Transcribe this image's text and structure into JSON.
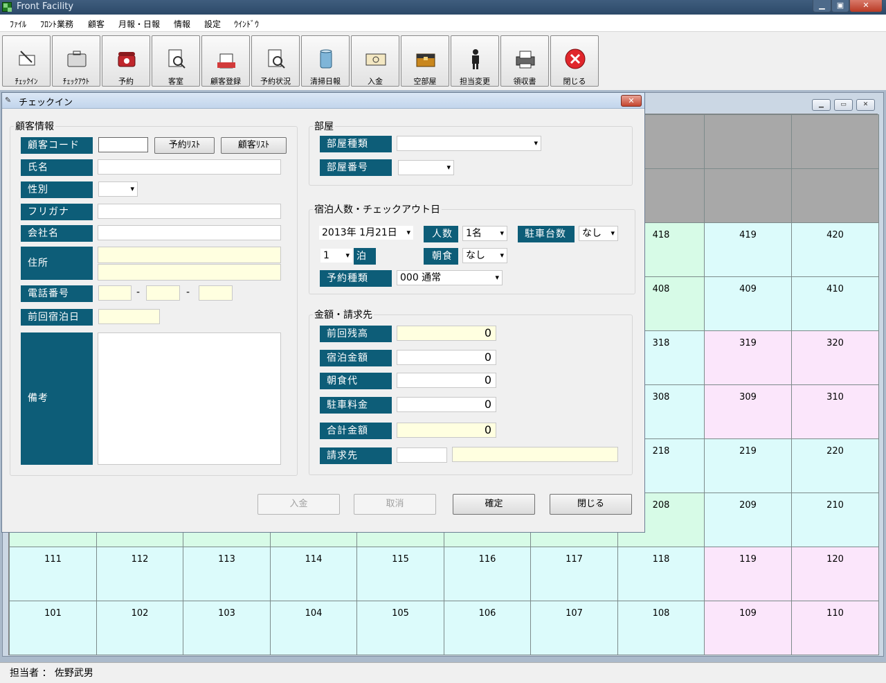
{
  "window": {
    "title": "Front Facility"
  },
  "menu": [
    "ﾌｧｲﾙ",
    "ﾌﾛﾝﾄ業務",
    "顧客",
    "月報・日報",
    "情報",
    "設定",
    "ｳｲﾝﾄﾞｳ"
  ],
  "toolbar": [
    {
      "label": "ﾁｪｯｸｲﾝ",
      "icon": "checkin-icon"
    },
    {
      "label": "ﾁｪｯｸｱｳﾄ",
      "icon": "checkout-icon"
    },
    {
      "label": "予約",
      "icon": "telephone-icon"
    },
    {
      "label": "客室",
      "icon": "room-search-icon"
    },
    {
      "label": "顧客登録",
      "icon": "customer-register-icon"
    },
    {
      "label": "予約状況",
      "icon": "reservation-status-icon"
    },
    {
      "label": "清掃日報",
      "icon": "cleaning-bin-icon"
    },
    {
      "label": "入金",
      "icon": "payment-icon"
    },
    {
      "label": "空部屋",
      "icon": "vacancy-box-icon"
    },
    {
      "label": "担当変更",
      "icon": "person-icon"
    },
    {
      "label": "領収書",
      "icon": "receipt-printer-icon"
    },
    {
      "label": "閉じる",
      "icon": "close-circle-icon"
    }
  ],
  "rooms": {
    "row4": [
      "418",
      "419",
      "420"
    ],
    "row3": [
      "408",
      "409",
      "410"
    ],
    "row2": [
      "318",
      "319",
      "320"
    ],
    "row1": [
      "308",
      "309",
      "310"
    ],
    "row0": [
      "218",
      "219",
      "220"
    ],
    "rowm": [
      "208",
      "209",
      "210"
    ],
    "row_b": [
      "111",
      "112",
      "113",
      "114",
      "115",
      "116",
      "117",
      "118",
      "119",
      "120"
    ],
    "row_a": [
      "101",
      "102",
      "103",
      "104",
      "105",
      "106",
      "107",
      "108",
      "109",
      "110"
    ]
  },
  "colors": {
    "cyan": "#dcfbfb",
    "green": "#d7fbe7",
    "pink": "#fbe6fb",
    "gray": "#a8a8a8",
    "label": "#0d5d78"
  },
  "dialog": {
    "title": "チェックイン",
    "customer": {
      "group_title": "顧客情報",
      "code_label": "顧客コード",
      "code_value": "",
      "reservation_list_btn": "予約ﾘｽﾄ",
      "customer_list_btn": "顧客ﾘｽﾄ",
      "name_label": "氏名",
      "gender_label": "性別",
      "furigana_label": "フリガナ",
      "company_label": "会社名",
      "address_label": "住所",
      "phone_label": "電話番号",
      "phone_sep": "-",
      "last_stay_label": "前回宿泊日",
      "notes_label": "備考"
    },
    "room": {
      "group_title": "部屋",
      "type_label": "部屋種類",
      "number_label": "部屋番号"
    },
    "stay": {
      "group_title": "宿泊人数・チェックアウト日",
      "date": "2013年  1月21日",
      "nights": "1",
      "nights_unit": "泊",
      "people_label": "人数",
      "people_value": "1名",
      "parking_label": "駐車台数",
      "parking_value": "なし",
      "breakfast_label": "朝食",
      "breakfast_value": "なし",
      "rsv_type_label": "予約種類",
      "rsv_type_value": "000 通常"
    },
    "amount": {
      "group_title": "金額・請求先",
      "prev_balance_label": "前回残高",
      "prev_balance": "0",
      "stay_fee_label": "宿泊金額",
      "stay_fee": "0",
      "breakfast_fee_label": "朝食代",
      "breakfast_fee": "0",
      "parking_fee_label": "駐車料金",
      "parking_fee": "0",
      "total_label": "合計金額",
      "total": "0",
      "billing_label": "請求先"
    },
    "buttons": {
      "payment": "入金",
      "cancel": "取消",
      "confirm": "確定",
      "close": "閉じる"
    }
  },
  "status": {
    "staff": "担当者 ： 佐野武男"
  }
}
